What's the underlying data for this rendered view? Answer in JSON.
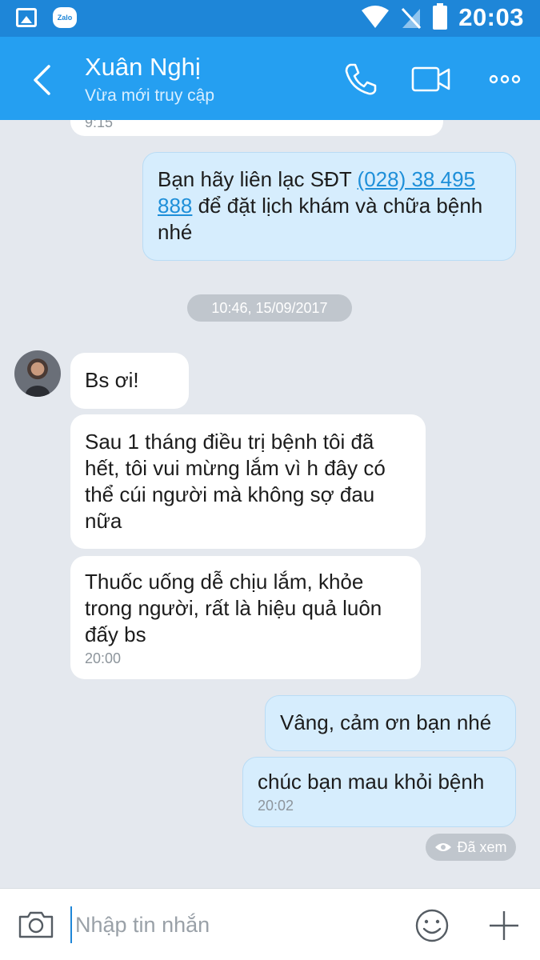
{
  "status_bar": {
    "time": "20:03",
    "zalo_icon_text": "Zalo"
  },
  "header": {
    "contact_name": "Xuân Nghị",
    "contact_status": "Vừa mới truy cập"
  },
  "messages": {
    "partial_time": "9:15",
    "out_1": {
      "text_before": "Bạn hãy liên lạc SĐT ",
      "phone": "(028) 38 495 888",
      "text_after": " để đặt lịch khám và chữa bệnh nhé"
    },
    "separator": "10:46, 15/09/2017",
    "in_1": "Bs ơi!",
    "in_2": "Sau 1 tháng điều trị bệnh tôi đã hết, tôi vui mừng lắm vì h đây có thể cúi người mà không sợ đau nữa",
    "in_3": "Thuốc uống dễ chịu lắm, khỏe trong người, rất là hiệu quả luôn đấy bs",
    "in_3_time": "20:00",
    "out_2": "Vâng, cảm ơn bạn nhé",
    "out_3": "chúc bạn mau khỏi bệnh",
    "out_3_time": "20:02",
    "seen": "Đã xem"
  },
  "input_bar": {
    "placeholder": "Nhập tin nhắn"
  },
  "colors": {
    "status_bar": "#1e86d8",
    "header": "#259ff1",
    "background": "#e4e8ee",
    "outgoing_bubble": "#d6edfd",
    "incoming_bubble": "#ffffff",
    "link": "#1e8fd9"
  },
  "icons": {
    "back": "chevron-left-icon",
    "call": "phone-icon",
    "video": "video-camera-icon",
    "more": "more-dots-icon",
    "camera": "camera-icon",
    "emoji": "emoji-icon",
    "plus": "plus-icon",
    "seen": "eye-icon"
  }
}
